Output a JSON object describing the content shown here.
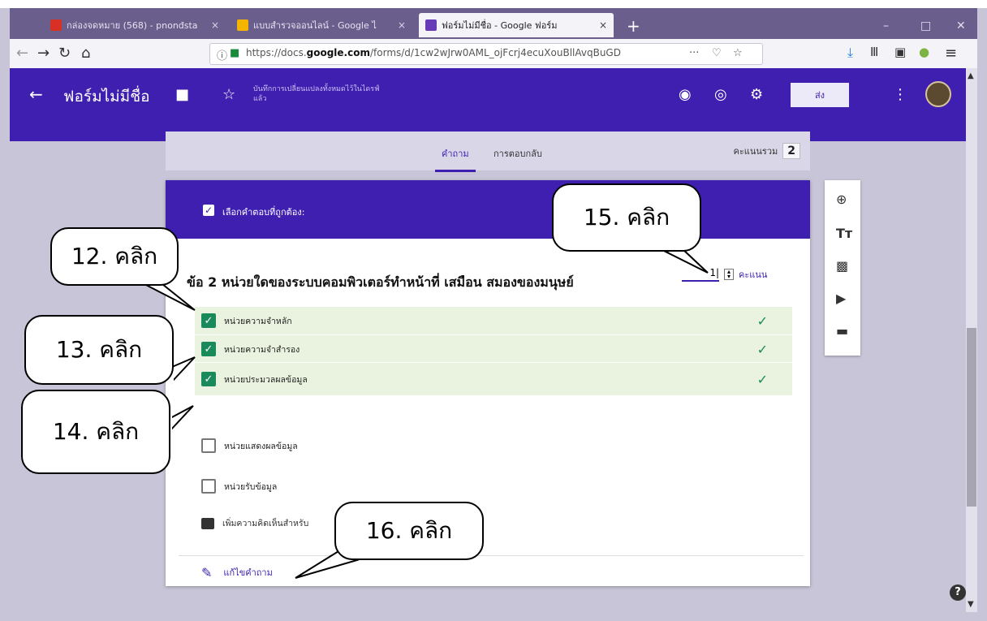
{
  "browser": {
    "tabs": [
      {
        "label": "กล่องจดหมาย (568) - pnonđsta",
        "fav_color": "#d93025"
      },
      {
        "label": "แบบสำรวจออนไลน์ - Google ไ",
        "fav_color": "#f4b400"
      },
      {
        "label": "ฟอร์มไม่มีชื่อ - Google ฟอร์ม",
        "fav_color": "#673ab7"
      }
    ],
    "tab_close": "×",
    "new_tab": "+",
    "url_prefix": "https://docs.",
    "url_domain": "google.com",
    "url_rest": "/forms/d/1cw2wJrw0AML_ojFcrj4ecuXouBllAvqBuGD",
    "url_more": "···"
  },
  "form": {
    "title": "ฟอร์มไม่มีชื่อ",
    "save_note": "บันทึกการเปลี่ยนแปลงทั้งหมดไว้ในไดรฟ์แล้ว",
    "send_label": "ส่ง",
    "tabs": [
      "คำถาม",
      "การตอบกลับ"
    ],
    "total_score_label": "คะแนนรวม",
    "total_score": "2"
  },
  "question": {
    "header_label": "เลือกคำตอบที่ถูกต้อง:",
    "title": "ข้อ 2 หน่วยใดของระบบคอมพิวเตอร์ทำหน้าที่ เสมือน สมองของมนุษย์",
    "points_value": "1|",
    "points_unit": "คะแนน",
    "options": [
      {
        "label": "หน่วยความจำหลัก",
        "checked": true
      },
      {
        "label": "หน่วยความจำสำรอง",
        "checked": true
      },
      {
        "label": "หน่วยประมวลผลข้อมูล",
        "checked": true
      },
      {
        "label": "หน่วยแสดงผลข้อมูล",
        "checked": false
      },
      {
        "label": "หน่วยรับข้อมูล",
        "checked": false
      }
    ],
    "comment_label": "เพิ่มความคิดเห็นสำหรับ",
    "edit_label": "แก้ไขคำถาม"
  },
  "callouts": {
    "c12": "12. คลิก",
    "c13": "13. คลิก",
    "c14": "14. คลิก",
    "c15": "15. คลิก",
    "c16": "16. คลิก"
  }
}
